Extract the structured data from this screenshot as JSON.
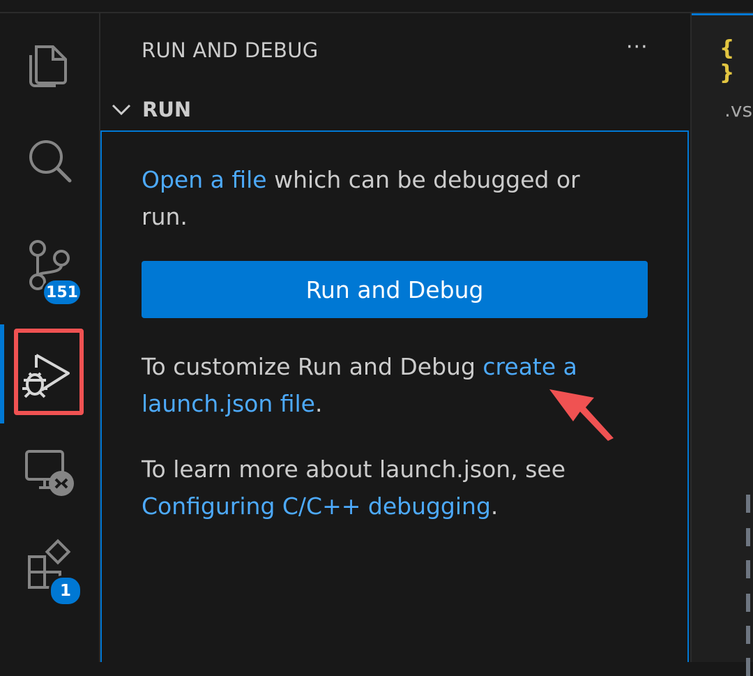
{
  "activity_bar": {
    "items": [
      {
        "name": "explorer",
        "icon": "files-icon"
      },
      {
        "name": "search",
        "icon": "search-icon"
      },
      {
        "name": "source-control",
        "icon": "source-control-icon",
        "badge": "151"
      },
      {
        "name": "run-and-debug",
        "icon": "run-debug-icon",
        "active": true
      },
      {
        "name": "remote-explorer",
        "icon": "remote-explorer-icon"
      },
      {
        "name": "extensions",
        "icon": "extensions-icon",
        "badge": "1"
      }
    ]
  },
  "sidebar": {
    "title": "RUN AND DEBUG",
    "more_actions": "···",
    "section": {
      "label": "RUN",
      "para1": {
        "link": "Open a file",
        "text": " which can be debugged or run."
      },
      "button_label": "Run and Debug",
      "para2": {
        "text": "To customize Run and Debug ",
        "link": "create a launch.json file",
        "suffix": "."
      },
      "para3": {
        "text": "To learn more about launch.json, see ",
        "link": "Configuring C/C++ debugging",
        "suffix": "."
      }
    }
  },
  "editor": {
    "tab_icon": "{ }",
    "breadcrumb": ".vs"
  },
  "colors": {
    "accent": "#0078d4",
    "link": "#4daafc",
    "highlight": "#f05252",
    "background": "#181818"
  }
}
